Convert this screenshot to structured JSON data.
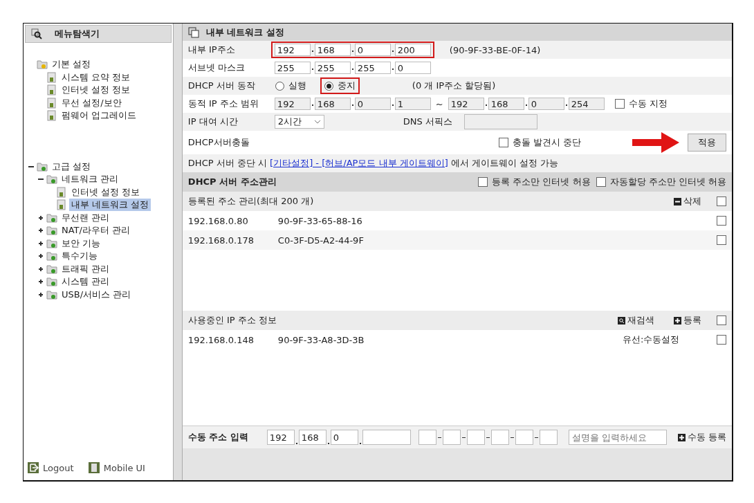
{
  "explorer": {
    "title": "메뉴탐색기",
    "tree": [
      {
        "label": "기본 설정",
        "selected": false,
        "children": [
          {
            "label": "시스템 요약 정보",
            "selected": false
          },
          {
            "label": "인터넷 설정 정보",
            "selected": false
          },
          {
            "label": "무선 설정/보안",
            "selected": false
          },
          {
            "label": "펌웨어 업그레이드",
            "selected": false
          }
        ]
      },
      {
        "label": "고급 설정",
        "selected": false,
        "expanded": true,
        "children": [
          {
            "label": "네트워크 관리",
            "selected": false,
            "expanded": true,
            "children": [
              {
                "label": "인터넷 설정 정보",
                "selected": false
              },
              {
                "label": "내부 네트워크 설정",
                "selected": true
              }
            ]
          },
          {
            "label": "무선랜 관리",
            "selected": false,
            "expanded": false
          },
          {
            "label": "NAT/라우터 관리",
            "selected": false,
            "expanded": false
          },
          {
            "label": "보안 기능",
            "selected": false,
            "expanded": false
          },
          {
            "label": "특수기능",
            "selected": false,
            "expanded": false
          },
          {
            "label": "트래픽 관리",
            "selected": false,
            "expanded": false
          },
          {
            "label": "시스템 관리",
            "selected": false,
            "expanded": false
          },
          {
            "label": "USB/서비스 관리",
            "selected": false,
            "expanded": false
          }
        ]
      }
    ],
    "footer": [
      {
        "label": "Logout"
      },
      {
        "label": "Mobile UI"
      }
    ]
  },
  "panel": {
    "title": "내부 네트워크 설정",
    "ip": {
      "label": "내부 IP주소",
      "octets": [
        "192",
        "168",
        "0",
        "200"
      ],
      "highlighted": true,
      "mac": "(90-9F-33-BE-0F-14)"
    },
    "subnet": {
      "label": "서브넷 마스크",
      "octets": [
        "255",
        "255",
        "255",
        "0"
      ]
    },
    "dhcp": {
      "label": "DHCP 서버 동작",
      "options": [
        {
          "label": "실행",
          "selected": false
        },
        {
          "label": "중지",
          "selected": true
        }
      ],
      "note": "(0 개 IP주소 할당됨)"
    },
    "range": {
      "label": "동적 IP 주소 범위",
      "start": [
        "192",
        "168",
        "0",
        "1"
      ],
      "separator": "~",
      "end": [
        "192",
        "168",
        "0",
        "254"
      ],
      "manual": {
        "label": "수동 지정",
        "checked": false
      }
    },
    "lease": {
      "label": "IP 대여 시간",
      "value": "2시간"
    },
    "dns": {
      "label": "DNS 서픽스"
    },
    "conflict": {
      "label": "DHCP서버충돌",
      "option": {
        "label": "충돌 발견시 중단",
        "checked": false
      },
      "apply": "적용"
    },
    "note": {
      "before": "DHCP 서버 중단 시 ",
      "link": "[기타설정] - [허브/AP모드 내부 게이트웨이]",
      "after": " 에서 게이트웨이 설정 가능"
    }
  },
  "dhcp_manage": {
    "title": "DHCP 서버 주소관리",
    "options": [
      {
        "label": "등록 주소만 인터넷 허용",
        "checked": false
      },
      {
        "label": "자동할당 주소만 인터넷 허용",
        "checked": false
      }
    ]
  },
  "registered": {
    "title": "등록된 주소 관리(최대 200 개)",
    "delete": "삭제",
    "checked": false,
    "rows": [
      {
        "ip": "192.168.0.80",
        "mac": "90-9F-33-65-88-16",
        "checked": false
      },
      {
        "ip": "192.168.0.178",
        "mac": "C0-3F-D5-A2-44-9F",
        "checked": false
      }
    ]
  },
  "in_use": {
    "title": "사용중인 IP 주소 정보",
    "rescan": "재검색",
    "register": "등록",
    "checked": false,
    "rows": [
      {
        "ip": "192.168.0.148",
        "mac": "90-9F-33-A8-3D-3B",
        "type": "유선:수동설정",
        "checked": false
      }
    ]
  },
  "manual": {
    "label": "수동 주소 입력",
    "octets": [
      "192",
      "168",
      "0"
    ],
    "placeholder": "설명을 입력하세요",
    "button": "수동 등록"
  }
}
